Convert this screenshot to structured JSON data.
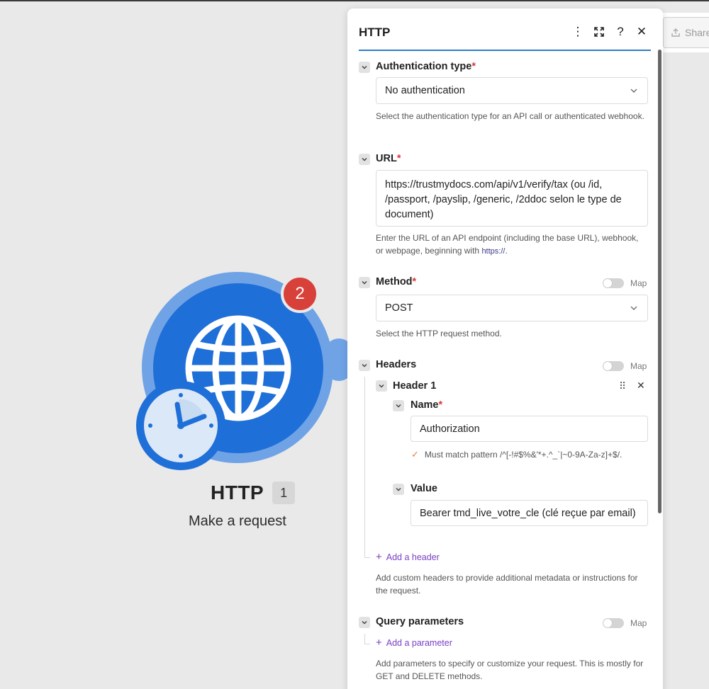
{
  "module": {
    "title": "HTTP",
    "count": "1",
    "subtitle": "Make a request",
    "badge": "2"
  },
  "share": {
    "label": "Share"
  },
  "panel": {
    "title": "HTTP",
    "auth": {
      "label": "Authentication type",
      "value": "No authentication",
      "help": "Select the authentication type for an API call or authenticated webhook."
    },
    "url": {
      "label": "URL",
      "value": "https://trustmydocs.com/api/v1/verify/tax (ou /id, /passport, /payslip, /generic, /2ddoc selon le type de document)",
      "help_prefix": "Enter the URL of an API endpoint (including the base URL), webhook, or webpage, beginning with ",
      "help_link": "https://",
      "help_suffix": "."
    },
    "method": {
      "label": "Method",
      "map_label": "Map",
      "value": "POST",
      "help": "Select the HTTP request method."
    },
    "headers": {
      "label": "Headers",
      "map_label": "Map",
      "header1": {
        "label": "Header 1",
        "name_label": "Name",
        "name_value": "Authorization",
        "pattern": "Must match pattern /^[-!#$%&'*+.^_`|~0-9A-Za-z]+$/.",
        "value_label": "Value",
        "value_value": "Bearer tmd_live_votre_cle (clé reçue par email)"
      },
      "add_label": "Add a header",
      "help": "Add custom headers to provide additional metadata or instructions for the request."
    },
    "query": {
      "label": "Query parameters",
      "map_label": "Map",
      "add_label": "Add a parameter",
      "help": "Add parameters to specify or customize your request. This is mostly for GET and DELETE methods."
    }
  },
  "colors": {
    "accent": "#2f7cc4",
    "required": "#d83a3a",
    "badge": "#d8403a",
    "link_purple": "#7b3fc4"
  },
  "icons": [
    "more-vertical-icon",
    "expand-icon",
    "help-icon",
    "close-icon",
    "chevron-down-icon",
    "drag-handle-icon",
    "globe-icon",
    "clock-icon",
    "share-icon",
    "check-icon",
    "plus-icon"
  ]
}
